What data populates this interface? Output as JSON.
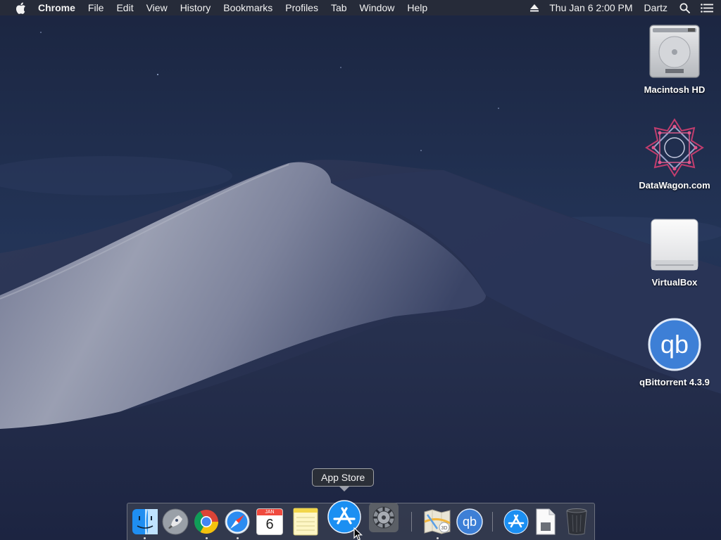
{
  "menubar": {
    "app_name": "Chrome",
    "menus": [
      "File",
      "Edit",
      "View",
      "History",
      "Bookmarks",
      "Profiles",
      "Tab",
      "Window",
      "Help"
    ],
    "clock": "Thu Jan 6  2:00 PM",
    "user": "Dartz"
  },
  "desktop": {
    "icons": [
      {
        "label": "Macintosh HD",
        "icon": "hard-drive-icon"
      },
      {
        "label": "DataWagon.com",
        "icon": "datawagon-star-icon"
      },
      {
        "label": "VirtualBox",
        "icon": "external-drive-icon"
      },
      {
        "label": "qBittorrent 4.3.9",
        "icon": "qbittorrent-icon"
      }
    ]
  },
  "tooltip": {
    "text": "App Store"
  },
  "dock": {
    "items": [
      {
        "name": "finder",
        "running": true
      },
      {
        "name": "launchpad",
        "running": false
      },
      {
        "name": "chrome",
        "running": true
      },
      {
        "name": "safari",
        "running": true
      },
      {
        "name": "calendar",
        "month": "JAN",
        "day": "6",
        "running": false
      },
      {
        "name": "notes",
        "running": false
      },
      {
        "name": "app-store",
        "running": false
      },
      {
        "name": "system-preferences",
        "running": false
      },
      {
        "name": "maps",
        "running": true
      },
      {
        "name": "qbittorrent",
        "label": "qb",
        "running": false
      },
      {
        "name": "app-store-downloads",
        "running": false
      },
      {
        "name": "document",
        "running": false
      },
      {
        "name": "trash",
        "running": false
      }
    ]
  },
  "colors": {
    "sky_top": "#1a2741",
    "sky_bottom": "#2c3d66",
    "dune_light": "#8d93a8",
    "dune_dark": "#262f4d",
    "qb_blue": "#3d7fd6"
  }
}
